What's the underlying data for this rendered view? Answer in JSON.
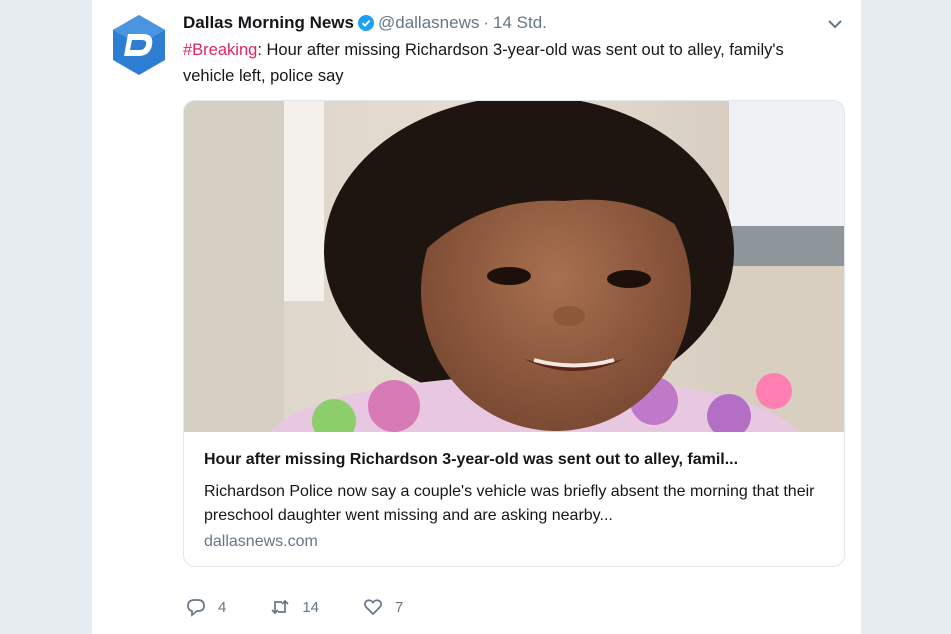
{
  "tweet": {
    "author_name": "Dallas Morning News",
    "handle": "@dallasnews",
    "separator": "·",
    "time": "14 Std.",
    "hashtag": "#Breaking",
    "text": ": Hour after missing Richardson 3-year-old was sent out to alley, family's vehicle left, police say",
    "avatar_icon": "dallas-news-logo-icon",
    "verified_icon": "verified-badge-icon",
    "menu_icon": "chevron-down-icon"
  },
  "link_card": {
    "title": "Hour after missing Richardson 3-year-old was sent out to alley, famil...",
    "description": "Richardson Police now say a couple's vehicle was briefly absent the morning that their preschool daughter went missing and are asking nearby...",
    "domain": "dallasnews.com"
  },
  "actions": {
    "replies": "4",
    "retweets": "14",
    "likes": "7"
  },
  "colors": {
    "hashtag": "#e0245e",
    "verified": "#1da1f2",
    "logo": "#2d7dd2",
    "background": "#e6ecf0"
  }
}
